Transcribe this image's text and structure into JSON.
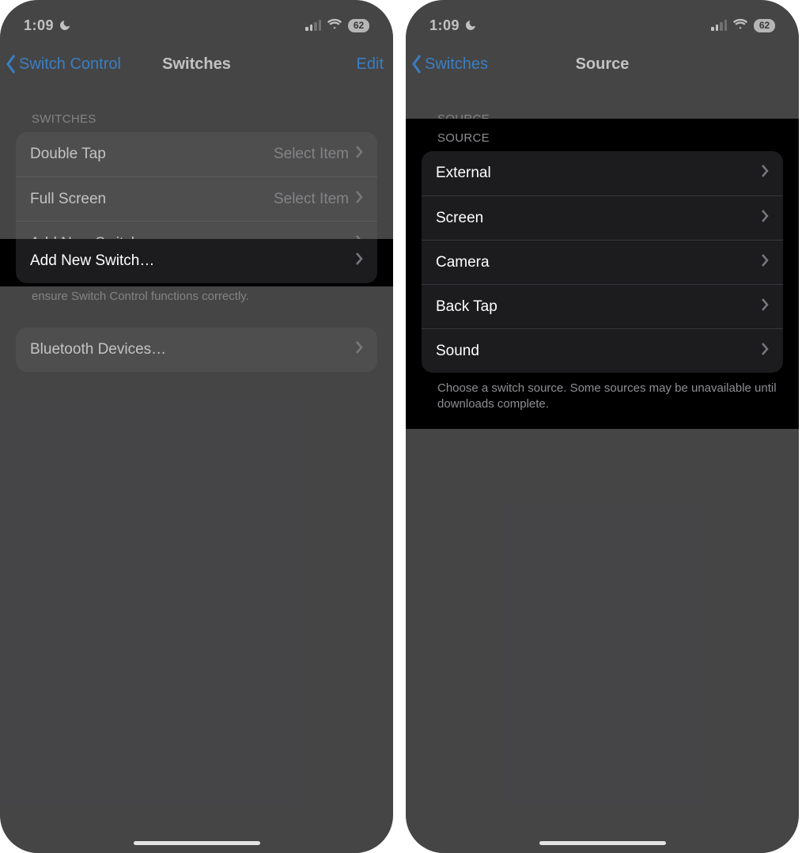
{
  "statusbar": {
    "time": "1:09",
    "battery": "62"
  },
  "left_screen": {
    "nav": {
      "back": "Switch Control",
      "title": "Switches",
      "edit": "Edit"
    },
    "section_header": "SWITCHES",
    "rows": [
      {
        "label": "Double Tap",
        "detail": "Select Item"
      },
      {
        "label": "Full Screen",
        "detail": "Select Item"
      },
      {
        "label": "Add New Switch…",
        "detail": ""
      }
    ],
    "footer": "One switch should be assigned to the Select Item action to ensure Switch Control functions correctly.",
    "bluetooth": "Bluetooth Devices…"
  },
  "right_screen": {
    "nav": {
      "back": "Switches",
      "title": "Source"
    },
    "section_header": "SOURCE",
    "rows": [
      {
        "label": "External"
      },
      {
        "label": "Screen"
      },
      {
        "label": "Camera"
      },
      {
        "label": "Back Tap"
      },
      {
        "label": "Sound"
      }
    ],
    "footer": "Choose a switch source. Some sources may be unavailable until downloads complete."
  }
}
